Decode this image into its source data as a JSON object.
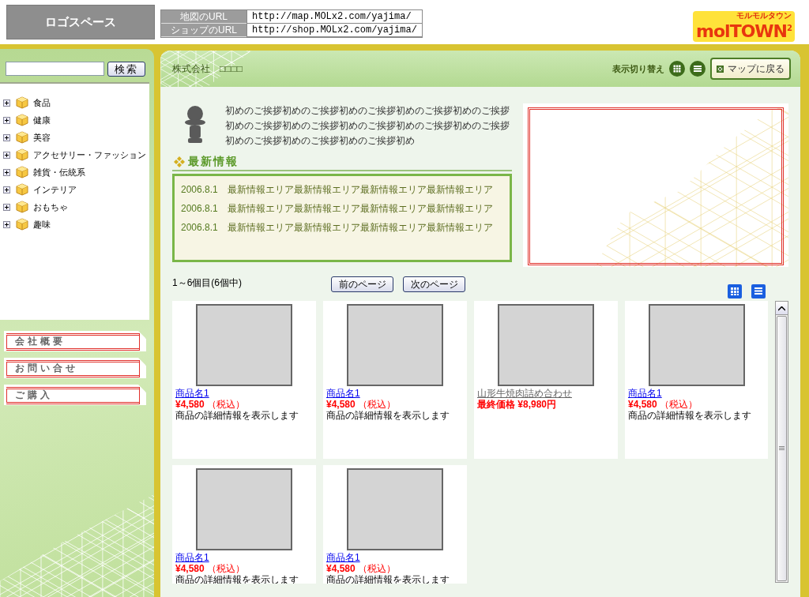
{
  "header": {
    "logo_placeholder": "ロゴスペース",
    "urls": [
      {
        "label": "地図のURL",
        "value": "http://map.MOLx2.com/yajima/"
      },
      {
        "label": "ショップのURL",
        "value": "http://shop.MOLx2.com/yajima/"
      }
    ],
    "brand_logo": {
      "wordmark": "molTOWN",
      "superscript": "2",
      "tagline": "モルモルタウン"
    }
  },
  "sidebar": {
    "search": {
      "button": "検索"
    },
    "categories": [
      {
        "label": "食品",
        "expanded": false
      },
      {
        "label": "健康",
        "expanded": false
      },
      {
        "label": "美容",
        "expanded": false
      },
      {
        "label": "アクセサリー・ファッション",
        "expanded": false
      },
      {
        "label": "雑貨・伝統系",
        "expanded": false
      },
      {
        "label": "インテリア",
        "expanded": false
      },
      {
        "label": "おもちゃ",
        "expanded": false
      },
      {
        "label": "趣味",
        "expanded": false
      }
    ],
    "menu_buttons": [
      "会社概要",
      "お問い合せ",
      "ご購入"
    ]
  },
  "main": {
    "company": "株式会社　□□□□",
    "view_switch": {
      "label": "表示切り替え"
    },
    "map_button": "マップに戻る",
    "greeting": "初めのご挨拶初めのご挨拶初めのご挨拶初めのご挨拶初めのご挨拶初めのご挨拶初めのご挨拶初めのご挨拶初めのご挨拶初めのご挨拶初めのご挨拶初めのご挨拶初めのご挨拶初め",
    "news": {
      "title": "最新情報",
      "items": [
        {
          "date": "2006.8.1",
          "text": "最新情報エリア最新情報エリア最新情報エリア最新情報エリア"
        },
        {
          "date": "2006.8.1",
          "text": "最新情報エリア最新情報エリア最新情報エリア最新情報エリア"
        },
        {
          "date": "2006.8.1",
          "text": "最新情報エリア最新情報エリア最新情報エリア最新情報エリア"
        }
      ]
    },
    "pagination": {
      "summary": "1～6個目(6個中)",
      "prev": "前のページ",
      "next": "次のページ"
    },
    "products": [
      {
        "kind": "standard",
        "name": "商品名1",
        "price": "¥4,580",
        "tax": "（税込）",
        "description": "商品の詳細情報を表示します"
      },
      {
        "kind": "standard",
        "name": "商品名1",
        "price": "¥4,580",
        "tax": "（税込）",
        "description": "商品の詳細情報を表示します"
      },
      {
        "kind": "final",
        "name": "山形牛焼肉詰め合わせ",
        "price": "最終価格 ¥8,980円"
      },
      {
        "kind": "standard",
        "name": "商品名1",
        "price": "¥4,580",
        "tax": "（税込）",
        "description": "商品の詳細情報を表示します"
      },
      {
        "kind": "standard",
        "name": "商品名1",
        "price": "¥4,580",
        "tax": "（税込）",
        "description": "商品の詳細情報を表示します"
      },
      {
        "kind": "standard",
        "name": "商品名1",
        "price": "¥4,580",
        "tax": "（税込）",
        "description": "商品の詳細情報を表示します"
      }
    ]
  }
}
